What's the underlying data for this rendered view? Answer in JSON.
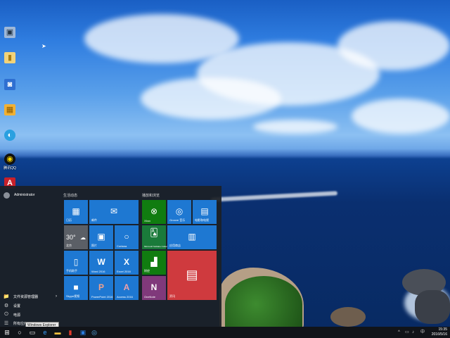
{
  "desktop": {
    "icons": [
      {
        "name": "computer-icon",
        "label": "",
        "color": "#9fb8d8",
        "glyph": "▣"
      },
      {
        "name": "folder-icon",
        "label": "",
        "color": "#f2d37a",
        "glyph": "▮"
      },
      {
        "name": "network-icon",
        "label": "",
        "color": "#2f6fd1",
        "glyph": "◙"
      },
      {
        "name": "package-icon",
        "label": "",
        "color": "#f2b134",
        "glyph": "▦"
      },
      {
        "name": "edge-icon",
        "label": "",
        "color": "#2aa0e0",
        "glyph": "◐"
      },
      {
        "name": "qq-icon",
        "label": "腾讯QQ",
        "color": "#111111",
        "glyph": "◉"
      },
      {
        "name": "acrobat-icon",
        "label": "",
        "color": "#c8202a",
        "glyph": "A"
      }
    ]
  },
  "start_menu": {
    "user": "Administrator",
    "left_items": [
      {
        "name": "file-explorer",
        "label": "文件资源管理器",
        "icon": "📁"
      },
      {
        "name": "settings",
        "label": "设置",
        "icon": "⚙"
      },
      {
        "name": "power",
        "label": "电源",
        "icon": "⏻"
      },
      {
        "name": "all-apps",
        "label": "所有应用",
        "icon": "☰"
      }
    ],
    "group_left_title": "生活动态",
    "group_right_title": "播放和浏览",
    "tiles": {
      "calendar": "日历",
      "mail": "邮件",
      "weather_city": "北京",
      "weather_temp": "30°",
      "photos": "照片",
      "cortana": "Cortana",
      "phone": "手机助手",
      "word": "Word 2016",
      "excel": "Excel 2016",
      "skype": "Skype视频",
      "powerpoint": "PowerPoint 2016",
      "access": "Access 2016",
      "xbox": "Xbox",
      "groove": "Groove 音乐",
      "movies": "电影和电视",
      "solitaire": "Microsoft Solitaire Collection",
      "store": "应用商店",
      "money": "财经",
      "onenote": "OneNote",
      "news": "资讯"
    }
  },
  "taskbar": {
    "tooltip": "Windows Explorer",
    "time": "15:35",
    "date": "2016/5/16",
    "lang": "中"
  }
}
